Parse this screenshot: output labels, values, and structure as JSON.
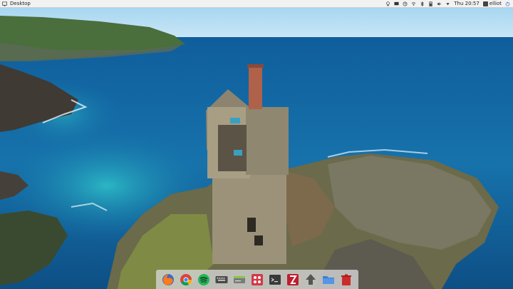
{
  "top_panel": {
    "app_title": "Desktop",
    "clock": "Thu 20:57",
    "username": "elliot",
    "indicators": [
      "bulb-icon",
      "display-icon",
      "update-icon",
      "wifi-icon",
      "bluetooth-icon",
      "battery-icon",
      "volume-icon",
      "dropdown-icon"
    ],
    "power_icon": "power-icon"
  },
  "dock": {
    "items": [
      {
        "icon": "firefox-icon",
        "color": "#e66000"
      },
      {
        "icon": "chrome-icon",
        "color": "#4285f4"
      },
      {
        "icon": "spotify-icon",
        "color": "#1db954"
      },
      {
        "icon": "keyboard-icon",
        "color": "#555555"
      },
      {
        "icon": "drive-icon",
        "color": "#6a6a6a"
      },
      {
        "icon": "apps-icon",
        "color": "#d33a47"
      },
      {
        "icon": "terminal-icon",
        "color": "#3a3a3a"
      },
      {
        "icon": "filezilla-icon",
        "color": "#bf1e2e"
      },
      {
        "icon": "download-icon",
        "color": "#555555"
      },
      {
        "icon": "files-icon",
        "color": "#3d7fd1"
      },
      {
        "icon": "trash-icon",
        "color": "#cc2b2b"
      }
    ]
  }
}
